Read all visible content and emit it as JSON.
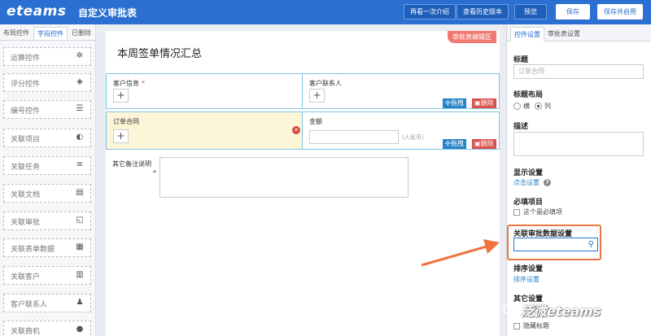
{
  "header": {
    "brand": "eteams",
    "title": "自定义审批表",
    "buttons": {
      "intro": "再看一次介绍",
      "history": "查看历史版本",
      "preview": "预览",
      "save": "保存",
      "save_enable": "保存并启用"
    }
  },
  "left_panel": {
    "tabs": [
      "布局控件",
      "字段控件",
      "已删除"
    ],
    "controls": [
      {
        "label": "运算控件",
        "icon": "gear-icon"
      },
      {
        "label": "评分控件",
        "icon": "layers-icon"
      },
      {
        "label": "编号控件",
        "icon": "numbered-list-icon"
      },
      {
        "label": "关联项目",
        "icon": "half-circle-icon"
      },
      {
        "label": "关联任务",
        "icon": "list-icon"
      },
      {
        "label": "关联文档",
        "icon": "document-icon"
      },
      {
        "label": "关联审批",
        "icon": "approval-icon"
      },
      {
        "label": "关联表单数据",
        "icon": "table-icon"
      },
      {
        "label": "关联客户",
        "icon": "building-icon"
      },
      {
        "label": "客户联系人",
        "icon": "person-icon"
      },
      {
        "label": "关联商机",
        "icon": "opportunity-icon"
      }
    ]
  },
  "canvas": {
    "badge": "审批表编辑区",
    "form_title": "本周签单情况汇总",
    "fields": {
      "customer_info": {
        "label": "客户信息",
        "required": "*"
      },
      "customer_contact": {
        "label": "客户联系人"
      },
      "order_contract": {
        "label": "订单合同"
      },
      "amount": {
        "label": "金额",
        "unit": "(人民币)"
      },
      "remarks": {
        "label": "其它备注说明",
        "required": "*"
      }
    },
    "drag_label": "拖拽",
    "delete_label": "删除"
  },
  "right_panel": {
    "tabs": [
      "控件设置",
      "审批表设置"
    ],
    "title_label": "标题",
    "title_placeholder": "订单合同",
    "title_layout": {
      "label": "标题布局",
      "options": [
        "横",
        "列"
      ]
    },
    "description_label": "描述",
    "display_settings": {
      "label": "显示设置",
      "link": "点击设置"
    },
    "required": {
      "label": "必填项目",
      "checkbox": "这个是必填项"
    },
    "related_approval": {
      "label": "关联审批数据设置"
    },
    "sort_settings": {
      "label": "排序设置",
      "link": "排序设置"
    },
    "other_settings": {
      "label": "其它设置",
      "visible_fragment": "单"
    },
    "hide_title": "隐藏标题"
  },
  "watermark": "泛微eteams",
  "colors": {
    "brand_blue": "#2a6fd1",
    "highlight_orange": "#ee7440",
    "danger_red": "#d9534f",
    "drag_blue": "#2a83c8"
  }
}
